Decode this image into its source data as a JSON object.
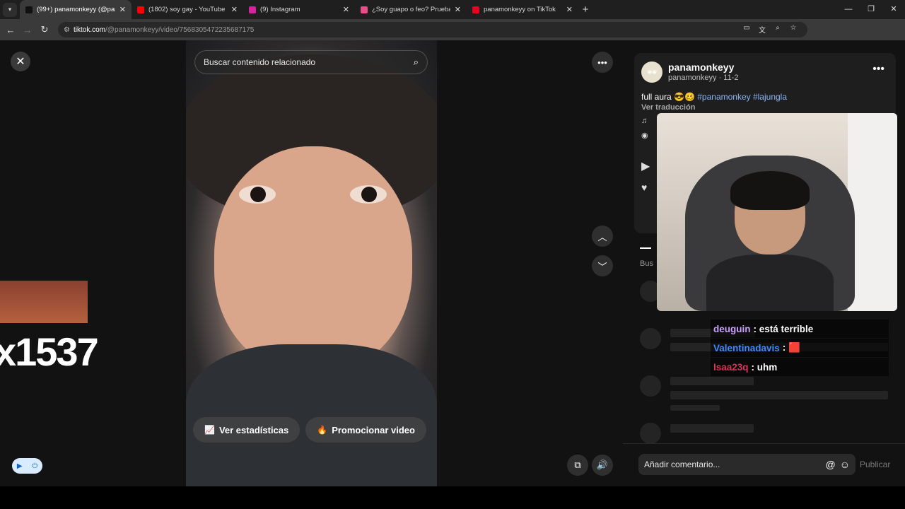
{
  "browser": {
    "tabs": [
      {
        "title": "(99+) panamonkeyy (@panamo",
        "favicon_color": "#111111",
        "active": true
      },
      {
        "title": "(1802) soy gay - YouTube",
        "favicon_color": "#ff0000",
        "active": false
      },
      {
        "title": "(9) Instagram",
        "favicon_color": "#d6249f",
        "active": false
      },
      {
        "title": "¿Soy guapo o feo? Prueba de a",
        "favicon_color": "#e84d8a",
        "active": false
      },
      {
        "title": "panamonkeyy on TikTok",
        "favicon_color": "#e60023",
        "active": false
      }
    ],
    "url_host": "tiktok.com",
    "url_path": "/@panamonkeyy/video/7568305472235687175"
  },
  "video": {
    "search_placeholder": "Buscar contenido relacionado",
    "stats_button": "Ver estadísticas",
    "promote_button": "Promocionar video"
  },
  "overlay": {
    "combo_count": "x1537"
  },
  "details": {
    "author_name": "panamonkeyy",
    "author_meta": "panamonkeyy · 11-2",
    "caption_text": "full aura 😎🥴 ",
    "hashtags": "#panamonkey #lajungla",
    "translate_label": "Ver traducción",
    "search_label": "Bus"
  },
  "chat": [
    {
      "user": "deuguin",
      "message": ": está terrible",
      "color": "#c9a0ff"
    },
    {
      "user": "Valentinadavis",
      "message": ": 🟥",
      "color": "#3d8bff"
    },
    {
      "user": "Isaa23q",
      "message": ": uhm",
      "color": "#e0305a"
    }
  ],
  "comments": {
    "placeholder": "Añadir comentario...",
    "publish_label": "Publicar"
  }
}
